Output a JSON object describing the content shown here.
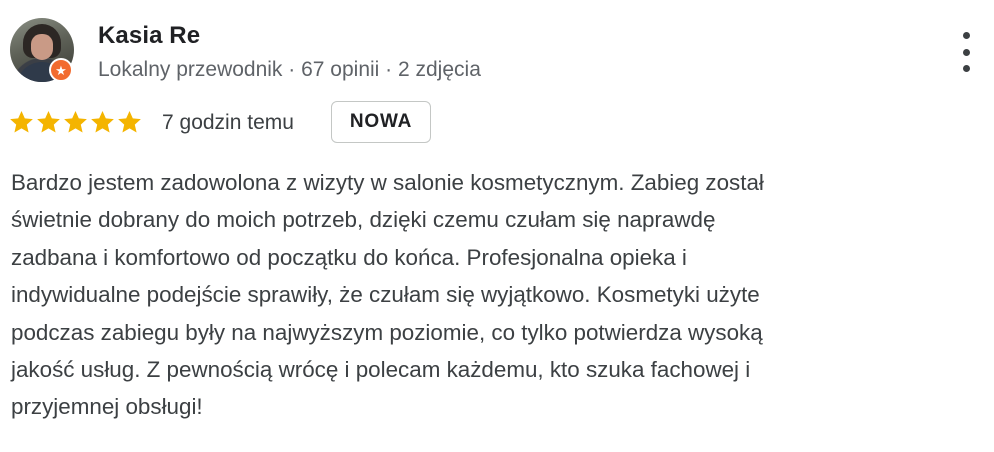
{
  "reviewer": {
    "name": "Kasia Re",
    "meta": "Lokalny przewodnik · 67 opinii · 2 zdjęcia",
    "avatar_icon": "user-photo",
    "badge_icon": "local-guide-star-icon",
    "badge_color": "#f26b2f"
  },
  "rating": {
    "stars": 5,
    "max": 5,
    "star_color": "#f4b400",
    "time_ago": "7 godzin temu",
    "new_label": "NOWA"
  },
  "menu": {
    "icon": "more-vert-icon"
  },
  "review": {
    "lines": [
      "Bardzo jestem zadowolona z wizyty w salonie kosmetycznym. Zabieg został",
      "świetnie dobrany do moich potrzeb, dzięki czemu czułam się naprawdę",
      "zadbana i komfortowo od początku do końca. Profesjonalna opieka i",
      "indywidualne podejście sprawiły, że czułam się wyjątkowo. Kosmetyki użyte",
      "podczas zabiegu były na najwyższym poziomie, co tylko potwierdza wysoką",
      "jakość usług. Z pewnością wrócę i polecam każdemu, kto szuka fachowej i",
      "przyjemnej obsługi!"
    ]
  }
}
